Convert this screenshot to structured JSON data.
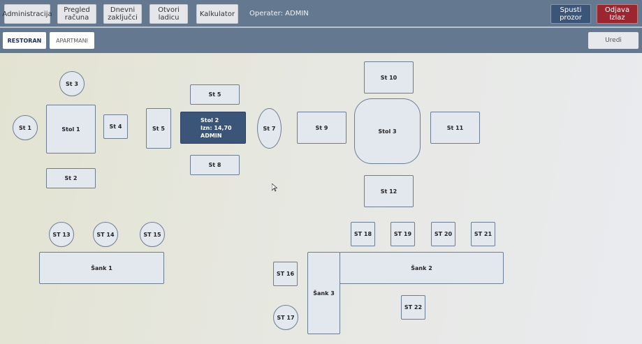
{
  "header": {
    "buttons": [
      "Administracija",
      "Pregled\nračuna",
      "Dnevni\nzaključci",
      "Otvori\nladicu",
      "Kalkulator"
    ],
    "operator": "Operater: ADMIN",
    "minimize": "Spusti\nprozor",
    "logout": "Odjava\nIzlaz"
  },
  "tabs": {
    "restoran": "RESTORAN",
    "apartmani": "APARTMANI",
    "edit": "Uredi"
  },
  "colors": {
    "bar": "#64788f",
    "selected": "#3b5579",
    "logout": "#9b2630"
  },
  "tables": {
    "st3": "St 3",
    "st1": "St 1",
    "stol1": "Stol 1",
    "st4": "St 4",
    "st2": "St 2",
    "st5a": "St 5",
    "st5b": "St 5",
    "st7": "St 7",
    "st8": "St 8",
    "st9": "St 9",
    "st10": "St 10",
    "stol3": "Stol 3",
    "st11": "St 11",
    "st12": "St 12",
    "st13": "ST 13",
    "st14": "ST 14",
    "st15": "ST 15",
    "sank1": "Šank 1",
    "st18": "ST 18",
    "st19": "ST 19",
    "st20": "ST 20",
    "st21": "ST 21",
    "sank2": "Šank 2",
    "sank3": "Šank 3",
    "st16": "ST 16",
    "st17": "ST 17",
    "st22": "ST 22"
  },
  "selected_table": {
    "name": "Stol 2",
    "amount": "Izn: 14,70",
    "user": "ADMIN"
  }
}
